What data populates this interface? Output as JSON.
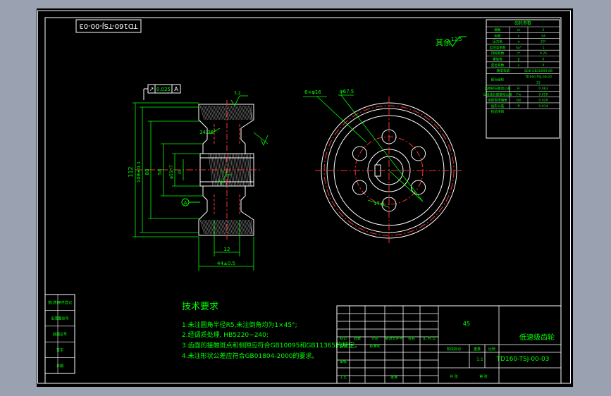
{
  "drawing": {
    "code_box": "TD160-TSJ-00-03",
    "roughness_note": "其余",
    "roughness_value": "12.5",
    "part_name": "低速级齿轮",
    "part_code": "TD160-TSJ-00-03",
    "material": "45",
    "scale": "1:1"
  },
  "tech": {
    "title": "技术要求",
    "lines": [
      "1.未注圆角半径R5,未注倒角均为1×45°;",
      "2.经调质处理, HB5220~240;",
      "3.齿面的接触斑点和侧隙应符合GB10095和GB11365的规定。",
      "4.未注形状公差应符合GB01804-2000的要求。"
    ]
  },
  "dims": {
    "tol_symbol": "↗",
    "tol_value": "0.025",
    "tol_datum": "A",
    "d1": "112",
    "d2": "108±0.1",
    "d3": "88",
    "d4": "58",
    "d5": "φ55H7",
    "d6": "35",
    "angle": "34.36°",
    "face_width": "44±0.5",
    "hub_width": "12",
    "ra_top": "3.2",
    "ra_mid": "3.2",
    "hole_label": "6×φ16",
    "hole_pcd": "φ67.5",
    "key_dim": "17.3",
    "datum_label": "A"
  },
  "params": {
    "title": "齿轮参数",
    "rows": [
      [
        "模数",
        "m",
        "2"
      ],
      [
        "齿数",
        "z",
        "54"
      ],
      [
        "压力角",
        "α",
        "20°"
      ],
      [
        "齿顶高系数",
        "ha*",
        "1"
      ],
      [
        "顶隙系数",
        "c*",
        "0.25"
      ],
      [
        "螺旋角",
        "β",
        "0"
      ],
      [
        "变位系数",
        "x",
        "0"
      ]
    ],
    "precision_label": "精度等级",
    "precision_value": "8GK GB10095-88",
    "pair_label": "配对齿轮",
    "pair_code": "TD160-TSJ-00-02",
    "pair_teeth": "22",
    "rows2": [
      [
        "齿圈径向跳动公差",
        "Fr",
        "0.063"
      ],
      [
        "公法线长度变动公差",
        "Fw",
        "0.050"
      ],
      [
        "齿距极限偏差",
        "fpt",
        "0.020"
      ],
      [
        "齿形公差",
        "ff",
        "0.014"
      ]
    ],
    "group_label": "检验项目"
  },
  "titleblock": {
    "rev_headers": [
      "标记",
      "处数",
      "分区",
      "更改文件号",
      "签名",
      "年.月.日"
    ],
    "row_labels": [
      "设计",
      "审核",
      "工艺"
    ],
    "standardization": "标准化",
    "approve": "批准",
    "stage_label": "阶段标记",
    "weight_label": "重量",
    "scale_label": "比例",
    "sheet_total": "共 张",
    "sheet_no": "第 张"
  },
  "sidebox": {
    "rows": [
      "借(通)用件登记",
      "旧底图总号",
      "底图总号",
      "签字",
      "日期"
    ]
  }
}
